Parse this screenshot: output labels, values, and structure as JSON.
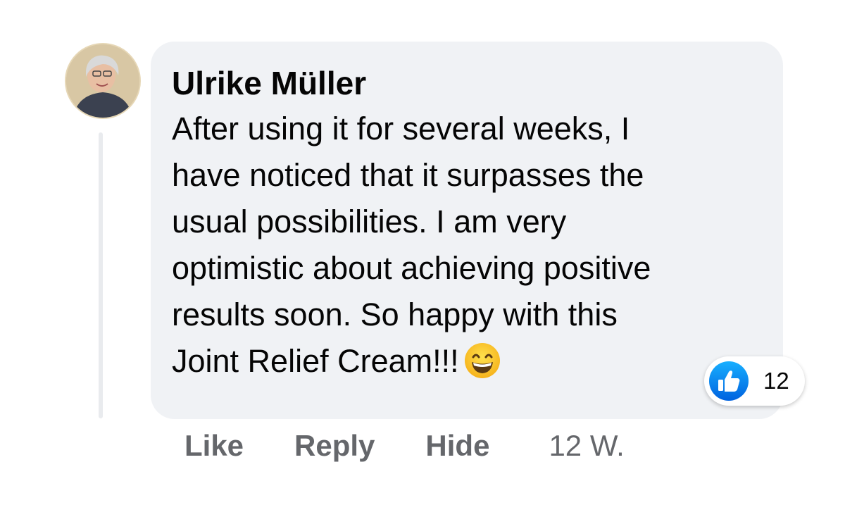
{
  "comment": {
    "author": "Ulrike Müller",
    "text_lines": [
      "After using it for several weeks, I",
      "have noticed that it surpasses the",
      "usual possibilities. I am very",
      "optimistic about achieving positive",
      "results soon. So happy with this",
      "Joint Relief Cream!!!"
    ],
    "emoji": "grinning-face-with-smiling-eyes-icon",
    "reactions": {
      "icon": "like-thumbs-up-icon",
      "count": "12"
    }
  },
  "actions": {
    "like": "Like",
    "reply": "Reply",
    "hide": "Hide",
    "timestamp": "12 W."
  },
  "colors": {
    "bubble_bg": "#f0f2f5",
    "action_text": "#65676b",
    "like_blue": "#1877f2"
  }
}
